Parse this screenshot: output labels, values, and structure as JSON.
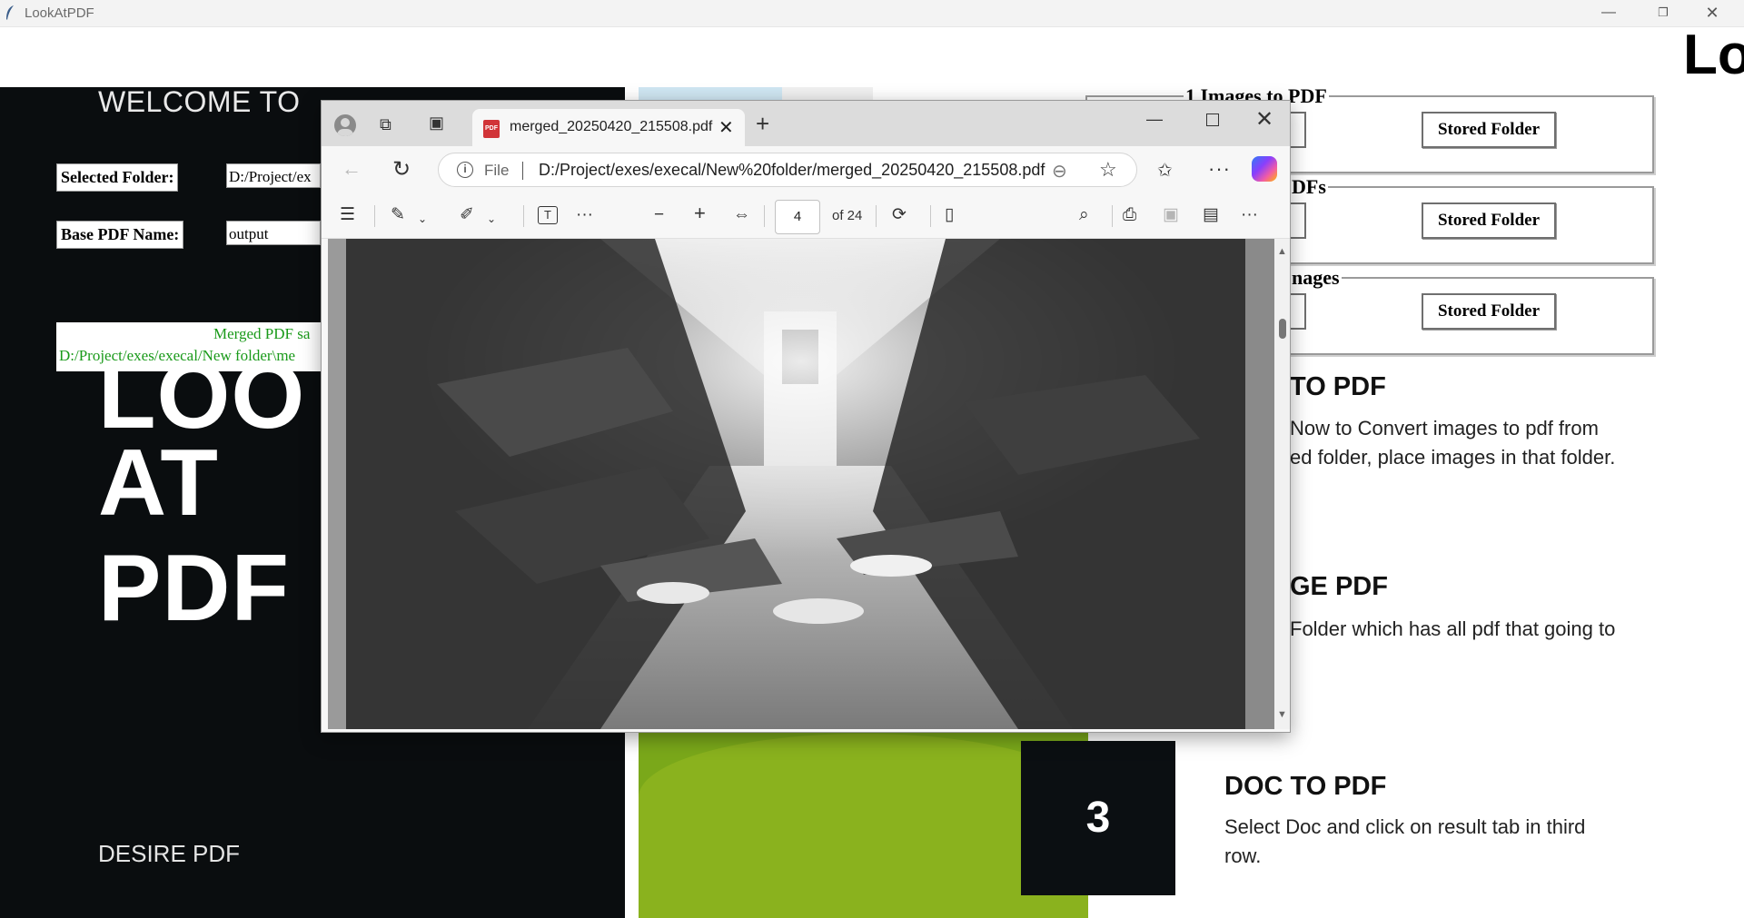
{
  "app": {
    "title": "LookAtPDF",
    "corner_text": "Lo"
  },
  "left_panel": {
    "welcome": "WELCOME TO",
    "selected_folder_label": "Selected Folder:",
    "selected_folder_value": "D:/Project/ex",
    "base_pdf_label": "Base PDF Name:",
    "base_pdf_value": "output",
    "status_line1": "Merged PDF sa",
    "status_line2": "D:/Project/exes/execal/New folder\\me",
    "hero_line1": "LOO",
    "hero_line2": "AT",
    "hero_line3": "PDF",
    "footer": "DESIRE PDF"
  },
  "middle": {
    "step_number": "3"
  },
  "right_panel": {
    "groups": [
      {
        "title": "1 Images to PDF",
        "button": "Stored Folder"
      },
      {
        "title": "DFs",
        "button": "Stored Folder"
      },
      {
        "title": "nages",
        "button": "Stored Folder"
      }
    ],
    "sections": [
      {
        "heading": "TO PDF",
        "text_line1": "Now to Convert images to pdf from",
        "text_line2": "ed folder, place images in that folder."
      },
      {
        "heading": "GE PDF",
        "text_line1": "Folder which has all pdf that going to",
        "text_line2": ""
      },
      {
        "heading": "DOC TO PDF",
        "text_line1": "Select Doc and click on result tab in third",
        "text_line2": "row."
      }
    ]
  },
  "browser": {
    "tab_title": "merged_20250420_215508.pdf",
    "address_scheme": "File",
    "address_url": "D:/Project/exes/execal/New%20folder/merged_20250420_215508.pdf",
    "page_current": "4",
    "page_total": "of 24",
    "pdf_icon_text": "PDF"
  },
  "colors": {
    "left_panel_bg": "#0a0d0f",
    "status_text": "#1a9a1a",
    "green_block": "#7aa81a"
  },
  "icons": [
    "profile-icon",
    "workspaces-icon",
    "tab-actions-icon",
    "pdf-icon",
    "close-icon",
    "plus-icon",
    "minimize-icon",
    "maximize-icon",
    "back-icon",
    "refresh-icon",
    "info-icon",
    "zoom-out-icon",
    "star-icon",
    "favorites-icon",
    "more-icon",
    "copilot-icon",
    "contents-icon",
    "highlight-icon",
    "draw-icon",
    "text-icon",
    "zoom-in-icon",
    "fit-width-icon",
    "rotate-icon",
    "page-view-icon",
    "search-icon",
    "print-icon",
    "save-icon",
    "save-as-icon"
  ]
}
